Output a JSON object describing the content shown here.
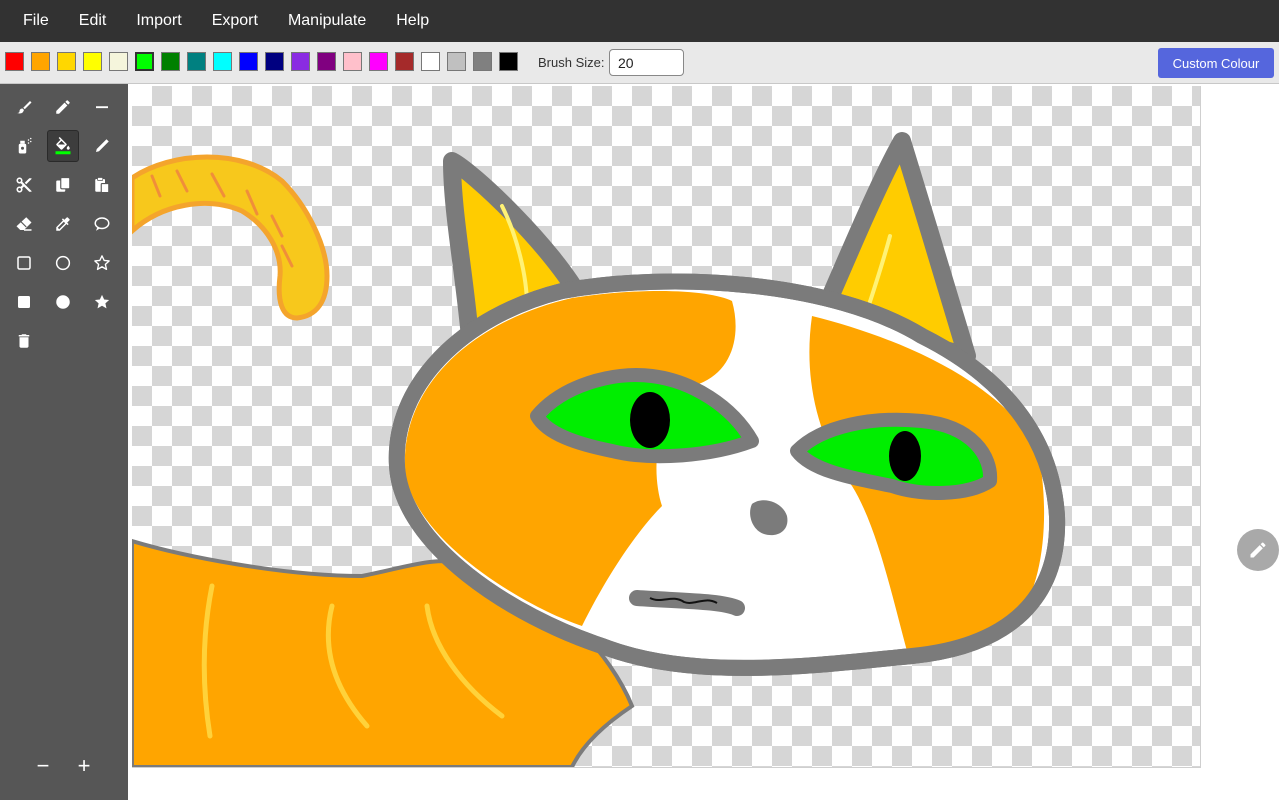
{
  "menu": {
    "items": [
      {
        "label": "File"
      },
      {
        "label": "Edit"
      },
      {
        "label": "Import"
      },
      {
        "label": "Export"
      },
      {
        "label": "Manipulate"
      },
      {
        "label": "Help"
      }
    ]
  },
  "toolbar": {
    "palette": [
      {
        "name": "red",
        "color": "#ff0000"
      },
      {
        "name": "orange",
        "color": "#ffa500"
      },
      {
        "name": "gold",
        "color": "#ffd700"
      },
      {
        "name": "yellow",
        "color": "#ffff00"
      },
      {
        "name": "beige",
        "color": "#f5f5dc"
      },
      {
        "name": "lime",
        "color": "#00ff00"
      },
      {
        "name": "green",
        "color": "#008000"
      },
      {
        "name": "teal",
        "color": "#008080"
      },
      {
        "name": "cyan",
        "color": "#00ffff"
      },
      {
        "name": "blue",
        "color": "#0000ff"
      },
      {
        "name": "navy",
        "color": "#000080"
      },
      {
        "name": "blueviolet",
        "color": "#8a2be2"
      },
      {
        "name": "purple",
        "color": "#800080"
      },
      {
        "name": "pink",
        "color": "#ffc0cb"
      },
      {
        "name": "magenta",
        "color": "#ff00ff"
      },
      {
        "name": "brown",
        "color": "#a52a2a"
      },
      {
        "name": "white",
        "color": "#ffffff"
      },
      {
        "name": "silver",
        "color": "#c0c0c0"
      },
      {
        "name": "gray",
        "color": "#808080"
      },
      {
        "name": "black",
        "color": "#000000"
      }
    ],
    "selected_color": "lime",
    "brush_size_label": "Brush Size:",
    "brush_size_value": "20",
    "custom_colour_label": "Custom Colour"
  },
  "tools": [
    {
      "name": "brush",
      "icon": "brush-icon"
    },
    {
      "name": "pencil",
      "icon": "pencil-icon"
    },
    {
      "name": "line",
      "icon": "line-icon"
    },
    {
      "name": "spray",
      "icon": "spray-can-icon"
    },
    {
      "name": "fill",
      "icon": "fill-bucket-icon",
      "active": true
    },
    {
      "name": "marker",
      "icon": "marker-icon"
    },
    {
      "name": "cut",
      "icon": "scissors-icon"
    },
    {
      "name": "copy",
      "icon": "copy-icon"
    },
    {
      "name": "paste",
      "icon": "paste-icon"
    },
    {
      "name": "eraser",
      "icon": "eraser-icon"
    },
    {
      "name": "eyedropper",
      "icon": "eyedropper-icon"
    },
    {
      "name": "speech-bubble",
      "icon": "speech-bubble-icon"
    },
    {
      "name": "rectangle-outline",
      "icon": "square-outline-icon"
    },
    {
      "name": "circle-outline",
      "icon": "circle-outline-icon"
    },
    {
      "name": "star-outline",
      "icon": "star-outline-icon"
    },
    {
      "name": "rectangle-filled",
      "icon": "square-filled-icon"
    },
    {
      "name": "circle-filled",
      "icon": "circle-filled-icon"
    },
    {
      "name": "star-filled",
      "icon": "star-filled-icon"
    },
    {
      "name": "clear",
      "icon": "trash-icon"
    }
  ],
  "zoom": {
    "minus_label": "−",
    "plus_label": "+"
  },
  "canvas": {
    "drawing": "cat-drawing",
    "background": "transparent-checkerboard"
  },
  "fab": {
    "icon": "pencil-icon"
  }
}
